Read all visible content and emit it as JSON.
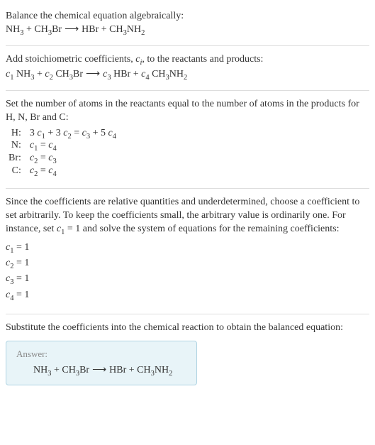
{
  "sec1": {
    "text": "Balance the chemical equation algebraically:",
    "eq": "NH₃ + CH₃Br ⟶ HBr + CH₃NH₂"
  },
  "sec2": {
    "text_a": "Add stoichiometric coefficients, ",
    "text_b": ", to the reactants and products:",
    "ci": "cᵢ",
    "eq": "c₁ NH₃ + c₂ CH₃Br ⟶ c₃ HBr + c₄ CH₃NH₂"
  },
  "sec3": {
    "text": "Set the number of atoms in the reactants equal to the number of atoms in the products for H, N, Br and C:",
    "rows": [
      {
        "el": "H:",
        "eq": "3 c₁ + 3 c₂ = c₃ + 5 c₄"
      },
      {
        "el": "N:",
        "eq": "c₁ = c₄"
      },
      {
        "el": "Br:",
        "eq": "c₂ = c₃"
      },
      {
        "el": "C:",
        "eq": "c₂ = c₄"
      }
    ]
  },
  "sec4": {
    "text": "Since the coefficients are relative quantities and underdetermined, choose a coefficient to set arbitrarily. To keep the coefficients small, the arbitrary value is ordinarily one. For instance, set c₁ = 1 and solve the system of equations for the remaining coefficients:",
    "coeffs": [
      "c₁ = 1",
      "c₂ = 1",
      "c₃ = 1",
      "c₄ = 1"
    ]
  },
  "sec5": {
    "text": "Substitute the coefficients into the chemical reaction to obtain the balanced equation:",
    "answer_label": "Answer:",
    "answer_eq": "NH₃ + CH₃Br ⟶ HBr + CH₃NH₂"
  }
}
